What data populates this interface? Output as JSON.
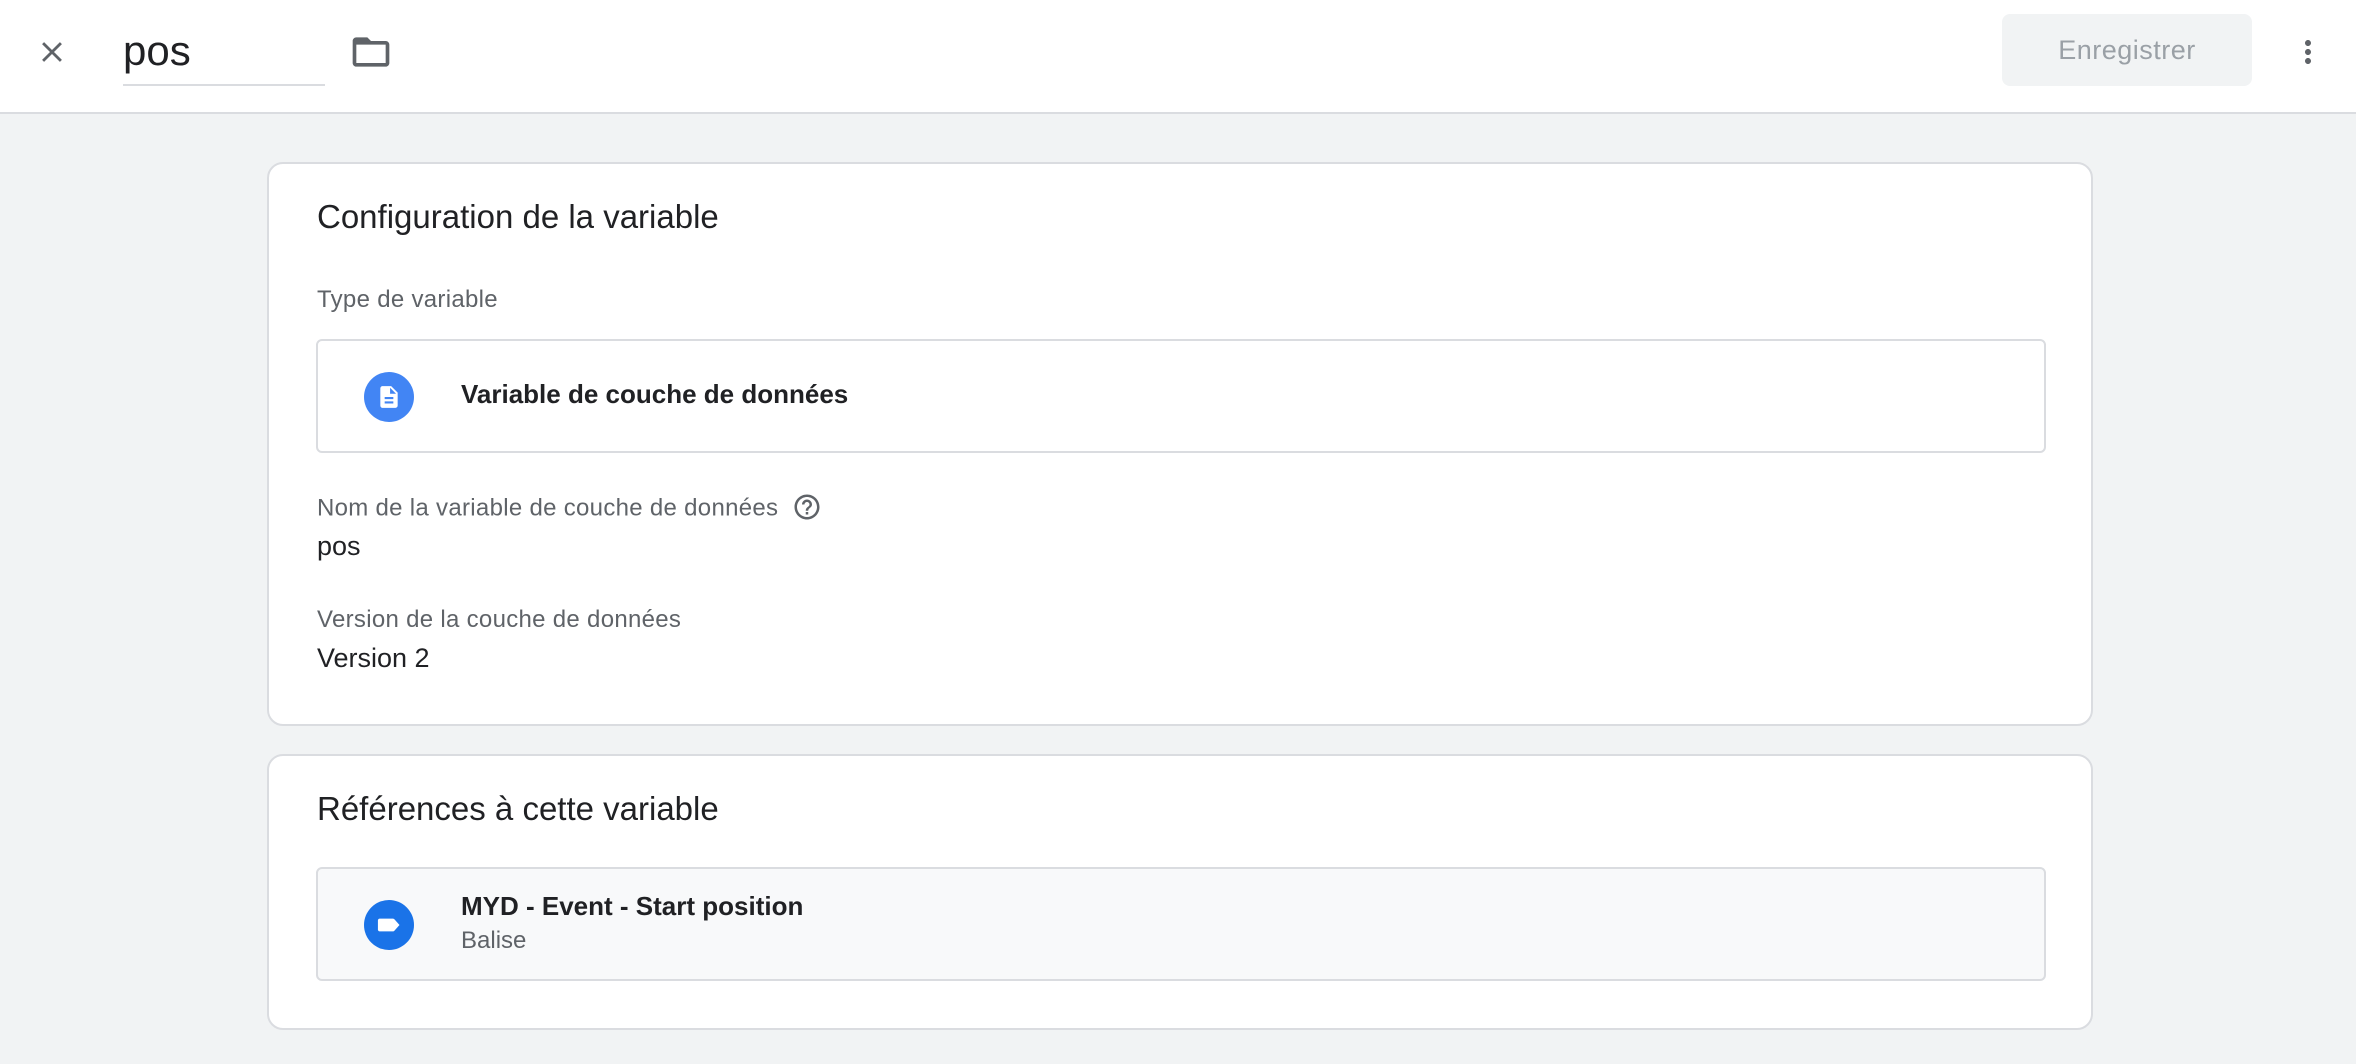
{
  "header": {
    "close_icon": "close-icon",
    "variable_name": "pos",
    "folder_icon": "folder-icon",
    "save_label": "Enregistrer",
    "more_icon": "more-vert-icon"
  },
  "config": {
    "title": "Configuration de la variable",
    "type_label": "Type de variable",
    "type_name": "Variable de couche de données",
    "type_icon": "document-icon",
    "type_icon_color": "#4285f4",
    "dl_name_label": "Nom de la variable de couche de données",
    "help_icon": "help-icon",
    "dl_name_value": "pos",
    "dl_version_label": "Version de la couche de données",
    "dl_version_value": "Version 2"
  },
  "references": {
    "title": "Références à cette variable",
    "items": [
      {
        "name": "MYD - Event - Start position",
        "type": "Balise",
        "icon": "tag-icon",
        "icon_color": "#1a73e8"
      }
    ]
  }
}
